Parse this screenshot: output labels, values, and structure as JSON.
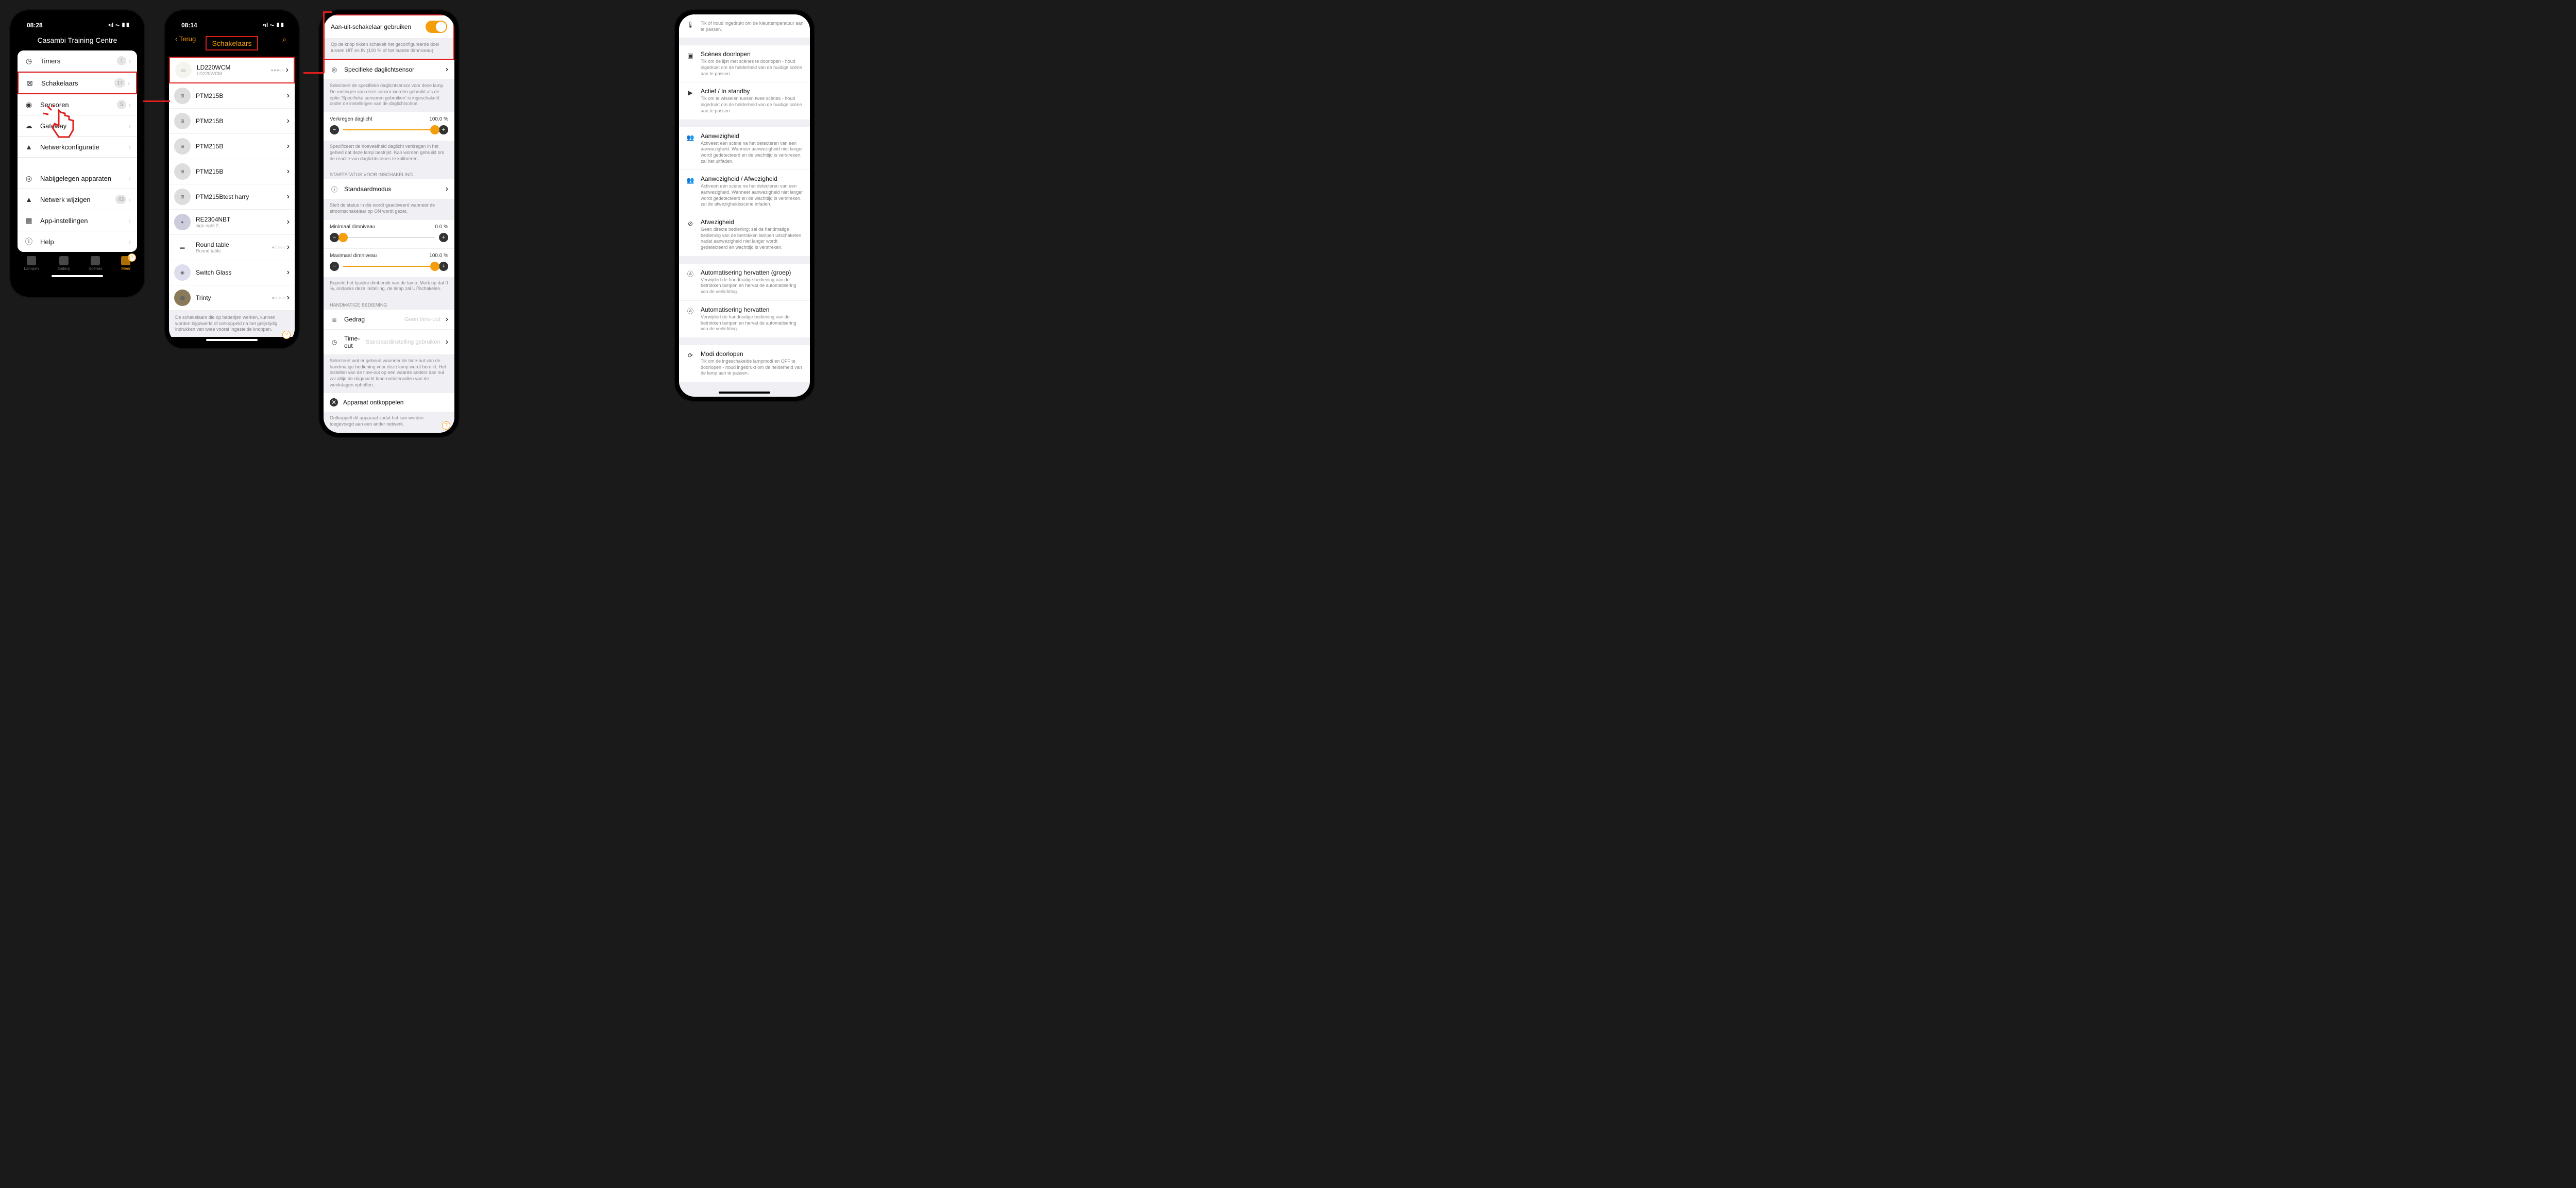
{
  "phone1": {
    "time": "08:28",
    "signal": "•ıl ⏦ ▮▮",
    "title": "Casambi Training Centre",
    "rows": [
      {
        "icon": "clock",
        "label": "Timers",
        "badge": "1"
      },
      {
        "icon": "switch",
        "label": "Schakelaars",
        "badge": "17"
      },
      {
        "icon": "sensor",
        "label": "Sensoren",
        "badge": "5"
      },
      {
        "icon": "cloud",
        "label": "Gateway",
        "badge": ""
      },
      {
        "icon": "net",
        "label": "Netwerkconfiguratie",
        "badge": ""
      }
    ],
    "rows2": [
      {
        "icon": "radar",
        "label": "Nabijgelegen apparaten",
        "badge": ""
      },
      {
        "icon": "edit",
        "label": "Netwerk wijzigen",
        "badge": "43"
      },
      {
        "icon": "grid",
        "label": "App-instellingen",
        "badge": ""
      },
      {
        "icon": "info",
        "label": "Help",
        "badge": ""
      }
    ],
    "tabs": [
      "Lampen",
      "Galerij",
      "Scènes",
      "Meer"
    ]
  },
  "phone2": {
    "time": "08:14",
    "back": "Terug",
    "title": "Schakelaars",
    "devices": [
      {
        "name": "LD220WCM",
        "sub": "LD220WCM",
        "dots": "●●●○○"
      },
      {
        "name": "PTM215B",
        "sub": "",
        "dots": ""
      },
      {
        "name": "PTM215B",
        "sub": "",
        "dots": ""
      },
      {
        "name": "PTM215B",
        "sub": "",
        "dots": ""
      },
      {
        "name": "PTM215B",
        "sub": "",
        "dots": ""
      },
      {
        "name": "PTM215Btest harry",
        "sub": "",
        "dots": ""
      },
      {
        "name": "RE2304NBT",
        "sub": "sign right 2,",
        "dots": ""
      },
      {
        "name": "Round table",
        "sub": "Round table",
        "dots": "●○○○○"
      },
      {
        "name": "Switch Glass",
        "sub": "",
        "dots": ""
      },
      {
        "name": "Trinty",
        "sub": "",
        "dots": "●○○○○"
      }
    ],
    "footnote": "De schakelaars die op batterijen werken, kunnen worden bijgewerkt of ontkoppeld na het gelijktijdig indrukken van twee vooraf ingestelde knoppen."
  },
  "phone3": {
    "use_switch_label": "Aan-uit-schakelaar gebruiken",
    "use_switch_desc": "Op de knop tikken schakelt het geconfigureerde doel tussen UIT en IN (100 % of het laatste dimniveau)",
    "daylight_label": "Specifieke daglichtsensor",
    "daylight_desc": "Selecteert de specifieke daglichtsensor voor deze lamp. De metingen van deze sensor worden gebruikt als de optie 'Specifieke sensoren gebruiken' is ingeschakeld onder de instellingen van de daglichtscène.",
    "gain_label": "Verkregen daglicht",
    "gain_value": "100.0 %",
    "gain_desc": "Specificeert de hoeveelheid daglicht verkregen in het gebied dat deze lamp bestrijkt. Kan worden gebruikt om de reactie van daglichtscènes te kalibreren.",
    "start_hdr": "STARTSTATUS VOOR INSCHAKELING",
    "default_label": "Standaardmodus",
    "default_desc": "Stelt de status in die wordt geactiveerd wanneer de stroomschakelaar op ON wordt gezet.",
    "min_label": "Minimaal dimniveau",
    "min_value": "0.0 %",
    "max_label": "Maximaal dimniveau",
    "max_value": "100.0 %",
    "dim_desc": "Beperkt het fysieke dimbereik van de lamp. Merk op dat 0 %, ondanks deze instelling, de lamp zal UITschakelen.",
    "manual_hdr": "HANDMATIGE BEDIENING",
    "behavior_label": "Gedrag",
    "behavior_value": "Geen time-out",
    "timeout_label": "Time-out",
    "timeout_value": "Standaardinstelling gebruiken",
    "timeout_desc": "Selecteert wat er gebeurt wanneer de time-out van de handmatige bediening voor deze lamp wordt bereikt. Het instellen van de time-out op een waarde anders dan nul zal altijd de dag/nacht time-outintervallen van de weekdagen opheffen.",
    "unpair_label": "Apparaat ontkoppelen",
    "unpair_desc": "Ontkoppelt dit apparaat zodat het kan worden toegevoegd aan een ander netwerk."
  },
  "phone4": {
    "opts": [
      {
        "icon": "temp",
        "title": "",
        "desc": "Tik of houd ingedrukt om de kleurtemperatuur aan te passen."
      },
      {
        "icon": "cycle",
        "title": "Scènes doorlopen",
        "desc": "Tik om de lijst met scènes te doorlopen - houd ingedrukt om de helderheid van de huidige scène aan te passen."
      },
      {
        "icon": "play",
        "title": "Actief / In standby",
        "desc": "Tik om te wisselen tussen twee scènes - houd ingedrukt om de helderheid van de huidige scène aan te passen."
      },
      {
        "icon": "users",
        "title": "Aanwezigheid",
        "desc": "Activeert een scène na het detecteren van een aanwezigheid. Wanneer aanwezigheid niet langer wordt gedetecteerd en de wachttijd is verstreken, zal het uitfaden."
      },
      {
        "icon": "users2",
        "title": "Aanwezigheid / Afwezigheid",
        "desc": "Activeert een scène na het detecteren van een aanwezigheid. Wanneer aanwezigheid niet langer wordt gedetecteerd en de wachttijd is verstreken, zal de afwezigheidsscène infaden."
      },
      {
        "icon": "nousers",
        "title": "Afwezigheid",
        "desc": "Geen directe bediening; zal de handmatige bediening van de betrokken lampen uitschakelen nadat aanwezigheid niet langer wordt gedetecteerd en wachttijd is verstreken."
      },
      {
        "icon": "auto",
        "title": "Automatisering hervatten (groep)",
        "desc": "Verwijdert de handmatige bediening van de betrokken lampen en hervat de automatisering van de verlichting."
      },
      {
        "icon": "auto",
        "title": "Automatisering hervatten",
        "desc": "Verwijdert de handmatige bediening van de betrokken lampen en hervat de automatisering van de verlichting."
      },
      {
        "icon": "modes",
        "title": "Modi doorlopen",
        "desc": "Tik om de ingeschakelde lampmodi en OFF te doorlopen - houd ingedrukt om de helderheid van de lamp aan te passen."
      }
    ]
  }
}
